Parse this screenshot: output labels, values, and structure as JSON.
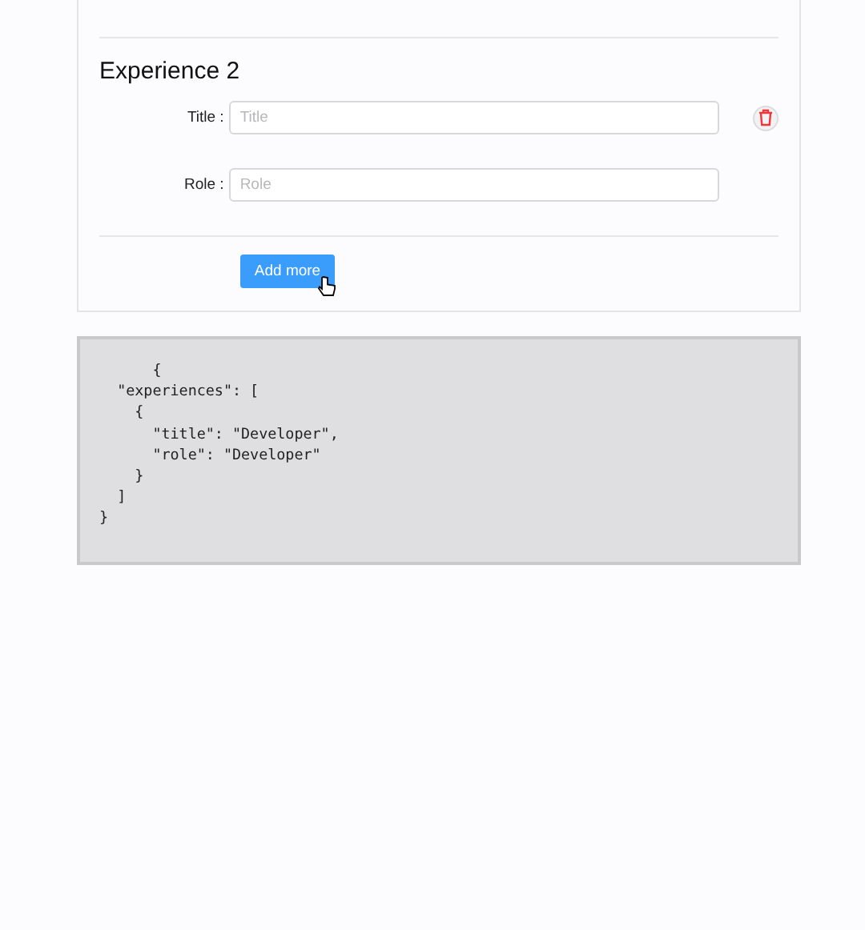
{
  "experience": {
    "heading": "Experience 2",
    "fields": [
      {
        "label": "Title :",
        "placeholder": "Title"
      },
      {
        "label": "Role :",
        "placeholder": "Role"
      }
    ],
    "add_button": "Add more"
  },
  "code_lines": [
    "      {",
    "  \"experiences\": [",
    "    {",
    "      \"title\": \"Developer\",",
    "      \"role\": \"Developer\"",
    "    }",
    "  ]",
    "}"
  ]
}
